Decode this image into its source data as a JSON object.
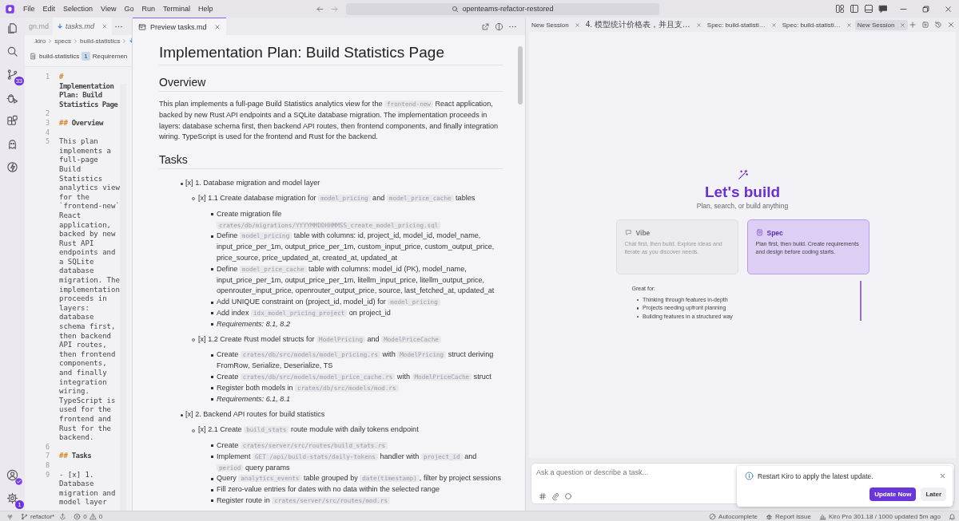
{
  "titlebar": {
    "menu": [
      "File",
      "Edit",
      "Selection",
      "View",
      "Go",
      "Run",
      "Terminal",
      "Help"
    ],
    "command_center": "openteams-refactor-restored"
  },
  "activity_bar": {
    "source_control_badge": "33",
    "settings_badge": "1"
  },
  "left_editor": {
    "tabs": [
      {
        "label": "gn.md",
        "selected": false
      },
      {
        "label": "tasks.md",
        "selected": true
      }
    ],
    "breadcrumb": [
      ".kiro",
      "specs",
      "build-statistics"
    ],
    "spec_toolbar": {
      "name": "build-statistics",
      "step": "1",
      "step_label": "Requiremen"
    },
    "lines": [
      {
        "number": "1",
        "marker": "#",
        "text": "Implementation Plan: Build Statistics Page"
      },
      {
        "number": "2"
      },
      {
        "number": "3",
        "marker": "##",
        "text": "Overview"
      },
      {
        "number": "4"
      },
      {
        "number": "5",
        "text": "This plan implements a full-page Build Statistics analytics view for the `frontend-new` React application, backed by new Rust API endpoints and a SQLite database migration. The implementation proceeds in layers: database schema first, then backend API routes, then frontend components, and finally integration wiring. TypeScript is used for the frontend and Rust for the backend."
      },
      {
        "number": "6"
      },
      {
        "number": "7",
        "marker": "##",
        "text": "Tasks"
      },
      {
        "number": "8"
      },
      {
        "number": "9",
        "text": "- [x] 1. Database migration and model layer"
      }
    ]
  },
  "preview": {
    "tab": "Preview tasks.md",
    "title": "Implementation Plan: Build Statistics Page",
    "overview": {
      "heading": "Overview",
      "parts": [
        "This plan implements a full-page Build Statistics analytics view for the ",
        {
          "code": "frontend-new"
        },
        " React application, backed by new Rust API endpoints and a SQLite database migration. The implementation proceeds in layers: database schema first, then backend API routes, then frontend components, and finally integration wiring. TypeScript is used for the frontend and Rust for the backend."
      ]
    },
    "tasks": {
      "heading": "Tasks",
      "items": [
        {
          "parts": [
            "[x] 1. Database migration and model layer"
          ],
          "children": [
            {
              "parts": [
                "[x] 1.1 Create database migration for ",
                {
                  "code": "model_pricing"
                },
                " and ",
                {
                  "code": "model_price_cache"
                },
                " tables"
              ],
              "children": [
                {
                  "kind": "step",
                  "parts": [
                    "Create migration file ",
                    {
                      "code": "crates/db/migrations/YYYYMMDDHHMMSS_create_model_pricing.sql"
                    }
                  ]
                },
                {
                  "kind": "step",
                  "parts": [
                    "Define ",
                    {
                      "code": "model_pricing"
                    },
                    " table with columns: id, project_id, model_id, model_name, input_price_per_1m, output_price_per_1m, custom_input_price, custom_output_price, price_source, price_updated_at, created_at, updated_at"
                  ]
                },
                {
                  "kind": "step",
                  "parts": [
                    "Define ",
                    {
                      "code": "model_price_cache"
                    },
                    " table with columns: model_id (PK), model_name, input_price_per_1m, output_price_per_1m, litellm_input_price, litellm_output_price, openrouter_input_price, openrouter_output_price, source, last_fetched_at, updated_at"
                  ]
                },
                {
                  "kind": "step",
                  "parts": [
                    "Add UNIQUE constraint on (project_id, model_id) for ",
                    {
                      "code": "model_pricing"
                    }
                  ]
                },
                {
                  "kind": "step",
                  "parts": [
                    "Add index ",
                    {
                      "code": "idx_model_pricing_project"
                    },
                    " on project_id"
                  ]
                },
                {
                  "kind": "note",
                  "parts": [
                    "Requirements: 8.1, 8.2"
                  ]
                }
              ]
            },
            {
              "parts": [
                "[x] 1.2 Create Rust model structs for ",
                {
                  "code": "ModelPricing"
                },
                " and ",
                {
                  "code": "ModelPriceCache"
                }
              ],
              "children": [
                {
                  "kind": "step",
                  "parts": [
                    "Create ",
                    {
                      "code": "crates/db/src/models/model_pricing.rs"
                    },
                    " with ",
                    {
                      "code": "ModelPricing"
                    },
                    " struct deriving FromRow, Serialize, Deserialize, TS"
                  ]
                },
                {
                  "kind": "step",
                  "parts": [
                    "Create ",
                    {
                      "code": "crates/db/src/models/model_price_cache.rs"
                    },
                    " with ",
                    {
                      "code": "ModelPriceCache"
                    },
                    " struct"
                  ]
                },
                {
                  "kind": "step",
                  "parts": [
                    "Register both models in ",
                    {
                      "code": "crates/db/src/models/mod.rs"
                    }
                  ]
                },
                {
                  "kind": "note",
                  "parts": [
                    "Requirements: 6.1, 8.1"
                  ]
                }
              ]
            }
          ]
        },
        {
          "parts": [
            "[x] 2. Backend API routes for build statistics"
          ],
          "children": [
            {
              "parts": [
                "[x] 2.1 Create ",
                {
                  "code": "build_stats"
                },
                " route module with daily tokens endpoint"
              ],
              "children": [
                {
                  "kind": "step",
                  "parts": [
                    "Create ",
                    {
                      "code": "crates/server/src/routes/build_stats.rs"
                    }
                  ]
                },
                {
                  "kind": "step",
                  "parts": [
                    "Implement ",
                    {
                      "code": "GET /api/build-stats/daily-tokens"
                    },
                    " handler with ",
                    {
                      "code": "project_id"
                    },
                    " and ",
                    {
                      "code": "period"
                    },
                    " query params"
                  ]
                },
                {
                  "kind": "step",
                  "parts": [
                    "Query ",
                    {
                      "code": "analytics_events"
                    },
                    " table grouped by ",
                    {
                      "code": "date(timestamp)"
                    },
                    ", filter by project sessions"
                  ]
                },
                {
                  "kind": "step",
                  "parts": [
                    "Fill zero-value entries for dates with no data within the selected range"
                  ]
                },
                {
                  "kind": "step",
                  "parts": [
                    "Register route in ",
                    {
                      "code": "crates/server/src/routes/mod.rs"
                    }
                  ]
                }
              ]
            }
          ]
        }
      ]
    }
  },
  "agent_panel": {
    "tabs": [
      {
        "label": "New Session",
        "selected": false
      },
      {
        "label": "4. 模型统计价格表，并且支…",
        "selected": false
      },
      {
        "label": "Spec: build-statisti…",
        "selected": false
      },
      {
        "label": "Spec: build-statisti…",
        "selected": false
      },
      {
        "label": "New Session",
        "selected": true
      }
    ],
    "title": "Let's build",
    "subtitle": "Plan, search, or build anything",
    "modes": [
      {
        "kind": "vibe",
        "title": "Vibe",
        "description": "Chat first, then build. Explore ideas and iterate as you discover needs.",
        "selected": false
      },
      {
        "kind": "spec",
        "title": "Spec",
        "description": "Plan first, then build. Create requirements and design before coding starts.",
        "selected": true
      }
    ],
    "great_for": {
      "label": "Great for:",
      "items": [
        "Thinking through features in-depth",
        "Projects needing upfront planning",
        "Building features in a structured way"
      ]
    },
    "chat_input": {
      "placeholder": "Ask a question or describe a task..."
    },
    "notification": {
      "message": "Restart Kiro to apply the latest update.",
      "buttons": [
        {
          "label": "Update Now",
          "kind": "primary"
        },
        {
          "label": "Later",
          "kind": "secondary"
        }
      ]
    }
  },
  "status_bar": {
    "branch": "refactor*",
    "errors": "0",
    "warnings": "0",
    "items": [
      {
        "kind": "autocomplete",
        "label": "Autocomplete"
      },
      {
        "kind": "report",
        "label": "Report issue"
      },
      {
        "kind": "usage",
        "label": "Kiro Pro 301.18 / 1000 updated 5m ago"
      }
    ]
  }
}
